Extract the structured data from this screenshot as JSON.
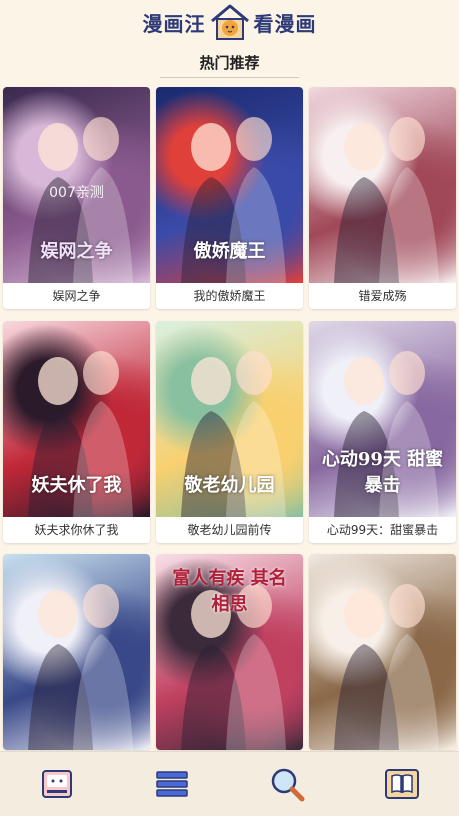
{
  "header": {
    "left_text": "漫画汪",
    "right_text": "看漫画",
    "logo_icon": "house-dog-logo-icon"
  },
  "section": {
    "title": "热门推荐"
  },
  "comics": [
    {
      "caption": "娱网之争",
      "cover_text": "娱网之争",
      "watermark": "007亲测",
      "colors": [
        "#3a2a4e",
        "#8a5a8e",
        "#d8b8d8"
      ]
    },
    {
      "caption": "我的傲娇魔王",
      "cover_text": "傲娇魔王",
      "colors": [
        "#1a2a6e",
        "#3a4aa8",
        "#e0403a"
      ]
    },
    {
      "caption": "错爱成殇",
      "cover_text": "",
      "colors": [
        "#f0d8e0",
        "#a04858",
        "#f8f0f0"
      ]
    },
    {
      "caption": "妖夫求你休了我",
      "cover_text": "妖夫休了我",
      "colors": [
        "#f8d8e0",
        "#c02838",
        "#2a1a2a"
      ]
    },
    {
      "caption": "敬老幼儿园前传",
      "cover_text": "敬老幼儿园",
      "colors": [
        "#d8f0e0",
        "#f8d070",
        "#88c0a0"
      ]
    },
    {
      "caption": "心动99天：甜蜜暴击",
      "cover_text": "心动99天 甜蜜暴击",
      "colors": [
        "#e0d8e8",
        "#8868a0",
        "#f0f0f8"
      ]
    },
    {
      "caption": "",
      "cover_text": "",
      "colors": [
        "#c8e0f0",
        "#384888",
        "#f0f0f8"
      ]
    },
    {
      "caption": "",
      "cover_text": "富人有疾 其名相思",
      "colors": [
        "#f8e0e8",
        "#c04060",
        "#3a2a3a"
      ]
    },
    {
      "caption": "",
      "cover_text": "",
      "colors": [
        "#f0e8e0",
        "#8a6848",
        "#f8f0e8"
      ]
    }
  ],
  "nav": [
    {
      "name": "home-pig-icon"
    },
    {
      "name": "menu-list-icon"
    },
    {
      "name": "search-icon"
    },
    {
      "name": "bookshelf-icon"
    }
  ]
}
